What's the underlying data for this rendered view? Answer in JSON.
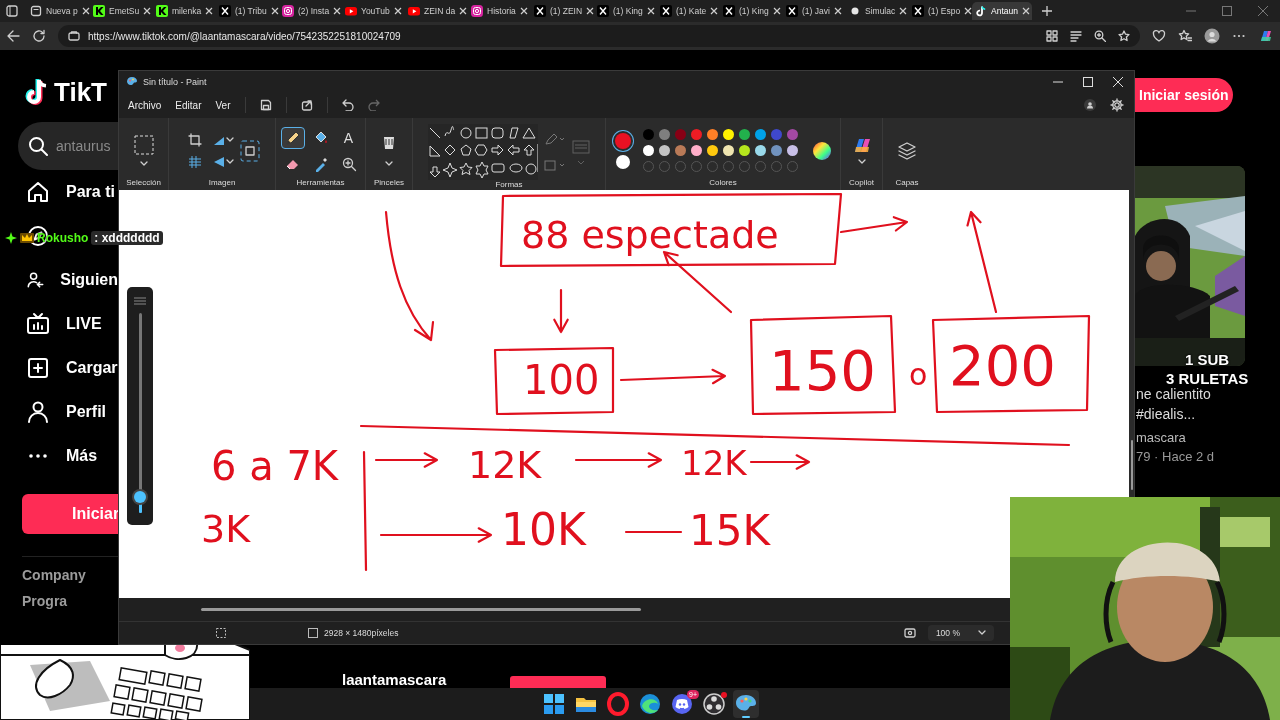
{
  "browser": {
    "tabs": [
      {
        "label": "Nueva p",
        "kind": "page",
        "selected": false
      },
      {
        "label": "EmetSu",
        "kind": "kick",
        "selected": false
      },
      {
        "label": "milenka",
        "kind": "kick",
        "selected": false
      },
      {
        "label": "(1) Tribu",
        "kind": "x",
        "selected": false
      },
      {
        "label": "(2) Insta",
        "kind": "instagram",
        "selected": false
      },
      {
        "label": "YouTub",
        "kind": "youtube",
        "selected": false
      },
      {
        "label": "ZEIN da",
        "kind": "youtube",
        "selected": false
      },
      {
        "label": "Historia",
        "kind": "instagram",
        "selected": false
      },
      {
        "label": "(1) ZEIN",
        "kind": "x",
        "selected": false
      },
      {
        "label": "(1) King",
        "kind": "x",
        "selected": false
      },
      {
        "label": "(1) Kate",
        "kind": "x",
        "selected": false
      },
      {
        "label": "(1) King",
        "kind": "x",
        "selected": false
      },
      {
        "label": "(1) Javi",
        "kind": "x",
        "selected": false
      },
      {
        "label": "Simulac",
        "kind": "dot",
        "selected": false
      },
      {
        "label": "(1) Espo",
        "kind": "x",
        "selected": false
      },
      {
        "label": "Antaun",
        "kind": "tiktok",
        "selected": true
      }
    ],
    "url": "https://www.tiktok.com/@laantamascara/video/7542352251810024709"
  },
  "tiktok": {
    "logo": "TikT",
    "search": {
      "value": "antaurus"
    },
    "nav": [
      {
        "label": "Para ti",
        "kind": "home"
      },
      {
        "kind": "compass"
      },
      {
        "label": "Siguien",
        "kind": "following"
      },
      {
        "label": "LIVE",
        "kind": "live"
      },
      {
        "label": "Cargar",
        "kind": "upload"
      },
      {
        "label": "Perfil",
        "kind": "profile"
      },
      {
        "label": "Más",
        "kind": "more"
      }
    ],
    "login_button": "Iniciar",
    "footer_links": [
      "Company",
      "Progra"
    ],
    "header_login": "Iniciar sesión",
    "side_video": {
      "title_lines": [
        "ne calientito",
        "#diealis..."
      ],
      "author": "mascara",
      "meta": "79 · Hace 2 d"
    },
    "bottom_author": "laantamascara"
  },
  "paint": {
    "title": "Sin título - Paint",
    "menu": [
      "Archivo",
      "Editar",
      "Ver"
    ],
    "groups": [
      {
        "label": "Selección",
        "kind": "selection"
      },
      {
        "label": "Imagen"
      },
      {
        "label": "Herramientas",
        "kind": "tools"
      },
      {
        "label": "Pinceles",
        "kind": "brushes"
      },
      {
        "label": "Formas",
        "kind": "shapes"
      },
      {
        "label": "Colores",
        "kind": "colors"
      },
      {
        "label": "Copilot",
        "kind": "copilot"
      },
      {
        "label": "Capas",
        "kind": "layers"
      }
    ],
    "tools": [
      {
        "kind": "pencil",
        "selected": true
      },
      {
        "kind": "fill",
        "selected": false
      },
      {
        "kind": "text",
        "glyph": "A",
        "selected": false
      },
      {
        "kind": "eraser",
        "selected": false
      },
      {
        "kind": "picker",
        "selected": false
      },
      {
        "kind": "magnifier",
        "selected": false
      }
    ],
    "palette": {
      "current": [
        {
          "color": "#e81123",
          "selected": true
        },
        {
          "color": "#ffffff",
          "selected": false
        }
      ],
      "colors": [
        {
          "color": "#000000"
        },
        {
          "color": "#7f7f7f"
        },
        {
          "color": "#880015"
        },
        {
          "color": "#ed1c24"
        },
        {
          "color": "#ff7f27"
        },
        {
          "color": "#fff200"
        },
        {
          "color": "#22b14c"
        },
        {
          "color": "#00a2e8"
        },
        {
          "color": "#3f48cc"
        },
        {
          "color": "#a349a4"
        },
        {
          "color": "#ffffff"
        },
        {
          "color": "#c3c3c3"
        },
        {
          "color": "#b97a57"
        },
        {
          "color": "#ffaec9"
        },
        {
          "color": "#ffc90e"
        },
        {
          "color": "#efe4b0"
        },
        {
          "color": "#b5e61d"
        },
        {
          "color": "#99d9ea"
        },
        {
          "color": "#7092be"
        },
        {
          "color": "#c8bfe7"
        }
      ]
    },
    "canvas": {
      "notes": [
        {
          "text": "88 espectade"
        },
        {
          "text": "100"
        },
        {
          "text": "150"
        },
        {
          "text": "o"
        },
        {
          "text": "200"
        },
        {
          "text": "6 a 7K"
        },
        {
          "text": "12K"
        },
        {
          "text": "12K"
        },
        {
          "text": "3K"
        },
        {
          "text": "10K"
        },
        {
          "text": "15K"
        }
      ]
    },
    "status": {
      "size": "2928 × 1480píxeles",
      "zoom": "100 %"
    }
  },
  "overlays": {
    "chat": {
      "user": "Rokusho",
      "message": ": xddddddd"
    },
    "volume": {
      "level": 0.08
    },
    "promo": [
      "1 SUB",
      "3 RULETAS"
    ]
  },
  "taskbar": {
    "apps": [
      {
        "kind": "start",
        "selected": false
      },
      {
        "kind": "files",
        "selected": false
      },
      {
        "kind": "opera",
        "selected": false
      },
      {
        "kind": "edge",
        "selected": false
      },
      {
        "kind": "discord",
        "badge": "9+",
        "selected": false
      },
      {
        "kind": "obs",
        "alert": true,
        "selected": false
      },
      {
        "kind": "paint",
        "selected": true
      }
    ]
  }
}
